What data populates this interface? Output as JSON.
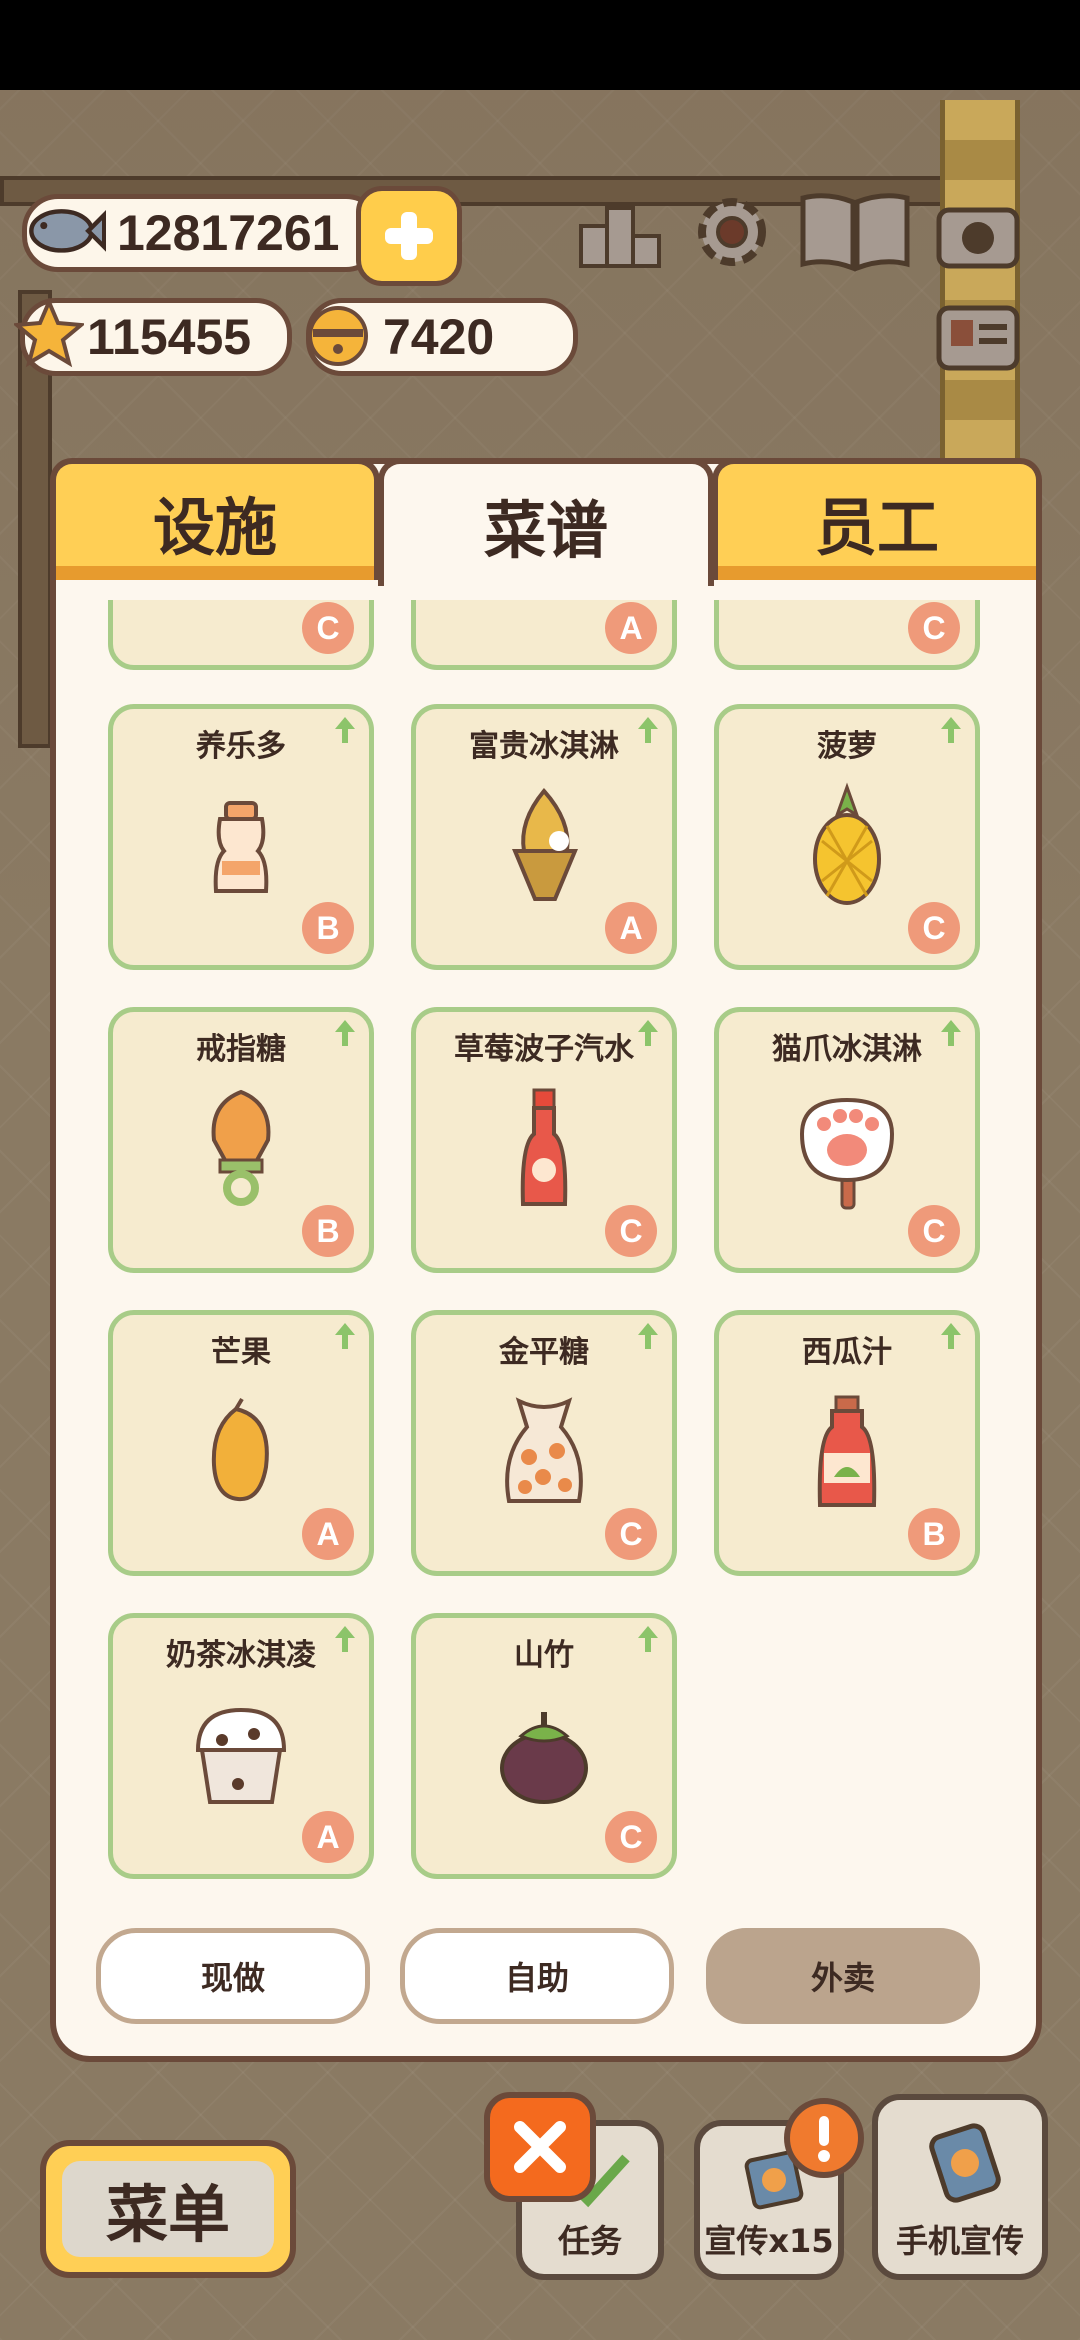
{
  "currency": {
    "fish": "12817261",
    "stars": "115455",
    "bells": "7420"
  },
  "tabs": [
    {
      "label": "设施",
      "active": false
    },
    {
      "label": "菜谱",
      "active": true
    },
    {
      "label": "员工",
      "active": false
    }
  ],
  "recipes_partial_top": [
    {
      "grade": "C"
    },
    {
      "grade": "A"
    },
    {
      "grade": "C"
    }
  ],
  "recipes": [
    {
      "name": "养乐多",
      "grade": "B",
      "icon": "yakult-bottle-icon"
    },
    {
      "name": "富贵冰淇淋",
      "grade": "A",
      "icon": "gold-ice-cream-icon"
    },
    {
      "name": "菠萝",
      "grade": "C",
      "icon": "pineapple-icon"
    },
    {
      "name": "戒指糖",
      "grade": "B",
      "icon": "ring-candy-icon"
    },
    {
      "name": "草莓波子汽水",
      "grade": "C",
      "icon": "strawberry-soda-icon"
    },
    {
      "name": "猫爪冰淇淋",
      "grade": "C",
      "icon": "cat-paw-ice-cream-icon"
    },
    {
      "name": "芒果",
      "grade": "A",
      "icon": "mango-icon"
    },
    {
      "name": "金平糖",
      "grade": "C",
      "icon": "konpeito-bag-icon"
    },
    {
      "name": "西瓜汁",
      "grade": "B",
      "icon": "watermelon-juice-icon"
    },
    {
      "name": "奶茶冰淇凌",
      "grade": "A",
      "icon": "milk-tea-ice-cream-icon"
    },
    {
      "name": "山竹",
      "grade": "C",
      "icon": "mangosteen-icon"
    }
  ],
  "modes": [
    {
      "label": "现做",
      "selected": false
    },
    {
      "label": "自助",
      "selected": false
    },
    {
      "label": "外卖",
      "selected": true
    }
  ],
  "bottom_bar": {
    "menu_label": "菜单",
    "task_label": "任务",
    "promo_label": "宣传x15",
    "phone_promo_label": "手机宣传"
  },
  "colors": {
    "accent_yellow": "#ffcf55",
    "card_border": "#a8cc88",
    "grade_badge": "#ef9a7a",
    "close_orange": "#f46a1e"
  }
}
